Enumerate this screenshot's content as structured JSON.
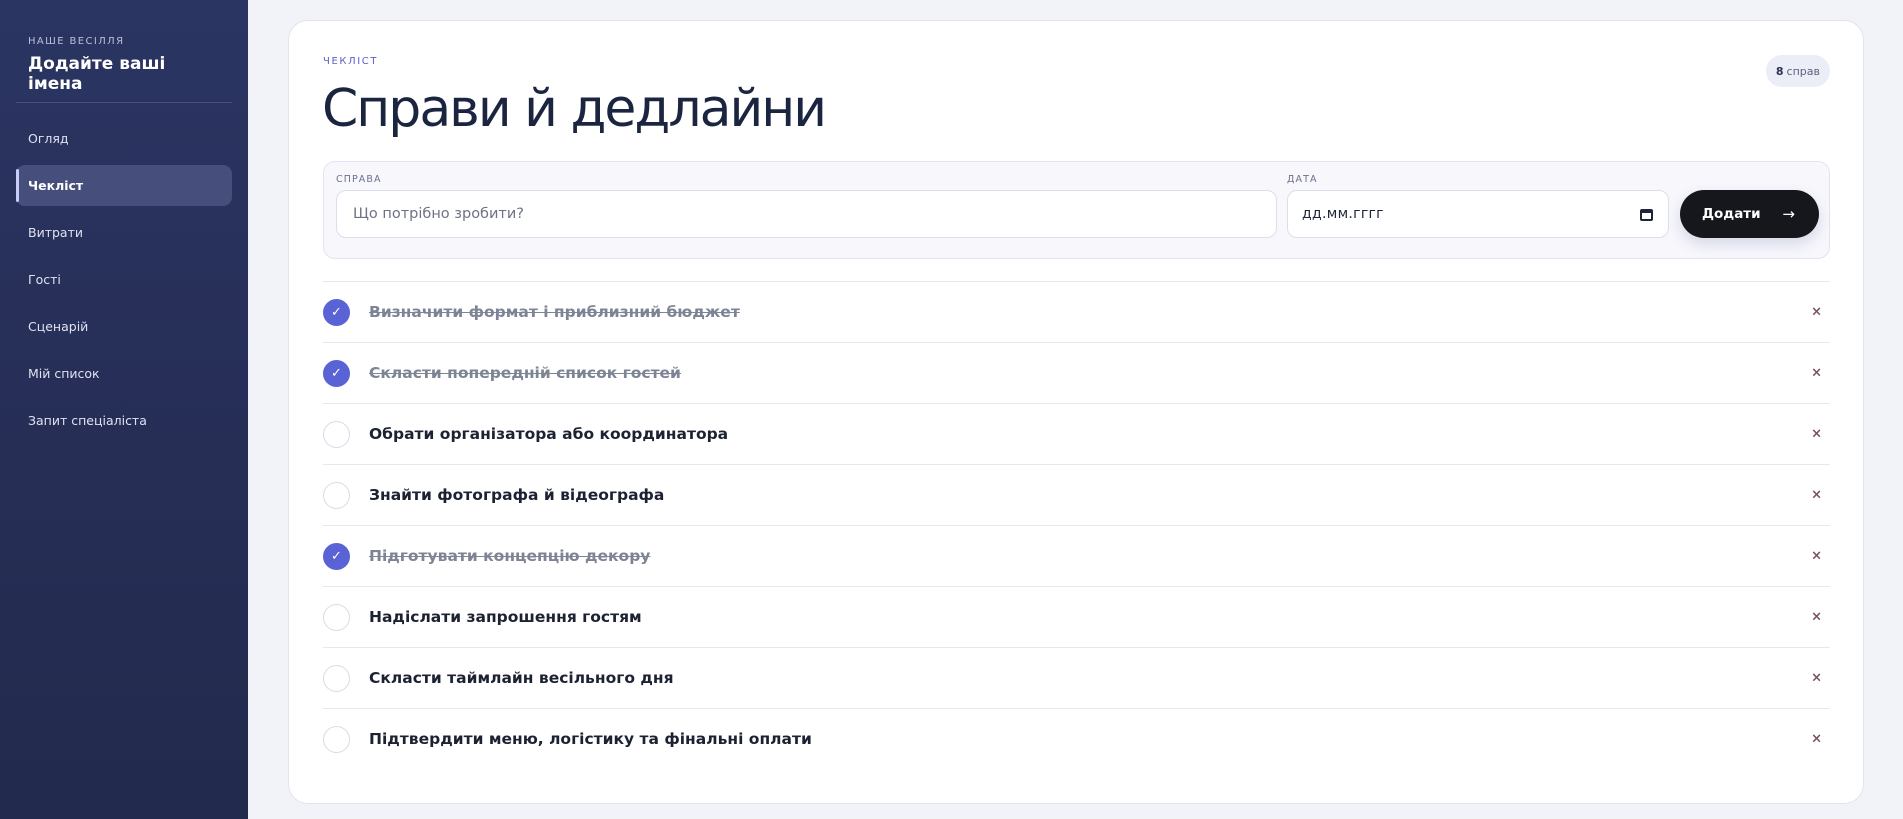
{
  "sidebar": {
    "kicker": "НАШЕ ВЕСІЛЛЯ",
    "title": "Додайте ваші імена",
    "items": [
      {
        "label": "Огляд",
        "active": false
      },
      {
        "label": "Чекліст",
        "active": true
      },
      {
        "label": "Витрати",
        "active": false
      },
      {
        "label": "Гості",
        "active": false
      },
      {
        "label": "Сценарій",
        "active": false
      },
      {
        "label": "Мій список",
        "active": false
      },
      {
        "label": "Запит спеціаліста",
        "active": false
      }
    ]
  },
  "main": {
    "kicker": "ЧЕКЛІСТ",
    "title": "Справи й дедлайни",
    "count": {
      "number": "8",
      "label": "справ"
    },
    "form": {
      "task_label": "СПРАВА",
      "task_placeholder": "Що потрібно зробити?",
      "task_value": "",
      "date_label": "ДАТА",
      "date_placeholder": "дд.мм.гггг",
      "add_label": "Додати",
      "add_icon": "arrow-right-icon"
    },
    "tasks": [
      {
        "text": "Визначити формат і приблизний бюджет",
        "done": true
      },
      {
        "text": "Скласти попередній список гостей",
        "done": true
      },
      {
        "text": "Обрати організатора або координатора",
        "done": false
      },
      {
        "text": "Знайти фотографа й відеографа",
        "done": false
      },
      {
        "text": "Підготувати концепцію декору",
        "done": true
      },
      {
        "text": "Надіслати запрошення гостям",
        "done": false
      },
      {
        "text": "Скласти таймлайн весільного дня",
        "done": false
      },
      {
        "text": "Підтвердити меню, логістику та фінальні оплати",
        "done": false
      }
    ],
    "delete_glyph": "×",
    "check_glyph": "✓"
  },
  "colors": {
    "sidebar_bg": "#262e56",
    "accent": "#5a63d6",
    "button_bg": "#16171c",
    "page_bg": "#f2f3f8"
  }
}
